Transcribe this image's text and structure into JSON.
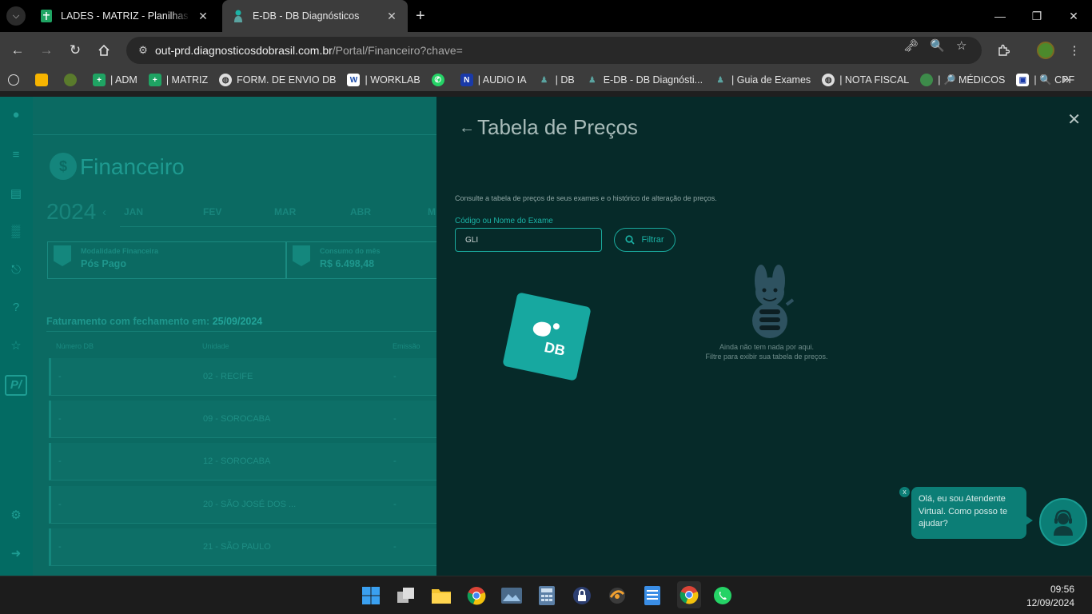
{
  "browser": {
    "tabs": [
      {
        "title": "LADES - MATRIZ - Planilhas Google",
        "active": false
      },
      {
        "title": "E-DB - DB Diagnósticos",
        "active": true
      }
    ],
    "url_host": "out-prd.diagnosticosdobrasil.com.br",
    "url_path": "/Portal/Financeiro?chave=",
    "bookmarks": [
      {
        "label": "",
        "icon": "openai-icon"
      },
      {
        "label": "",
        "icon": "keep-icon"
      },
      {
        "label": "",
        "icon": "badge-icon"
      },
      {
        "label": "| ADM",
        "icon": "sheets-icon"
      },
      {
        "label": "| MATRIZ",
        "icon": "sheets-icon"
      },
      {
        "label": "FORM. DE ENVIO DB",
        "icon": "globe-icon"
      },
      {
        "label": "| WORKLAB",
        "icon": "worklab-icon"
      },
      {
        "label": "",
        "icon": "whatsapp-icon"
      },
      {
        "label": "| AUDIO IA",
        "icon": "n-icon"
      },
      {
        "label": "| DB",
        "icon": "db-person-icon"
      },
      {
        "label": "E-DB - DB Diagnósti...",
        "icon": "db-person-icon"
      },
      {
        "label": "| Guia de Exames",
        "icon": "db-person-icon"
      },
      {
        "label": "| NOTA FISCAL",
        "icon": "globe-icon"
      },
      {
        "label": "| 🔎 MÉDICOS",
        "icon": "medico-icon"
      },
      {
        "label": "| 🔍 CPF",
        "icon": "receita-icon"
      }
    ]
  },
  "page": {
    "section_title": "Financeiro",
    "year": "2024",
    "months": [
      "JAN",
      "FEV",
      "MAR",
      "ABR",
      "M"
    ],
    "cards": [
      {
        "label": "Modalidade Financeira",
        "value": "Pós Pago"
      },
      {
        "label": "Consumo do mês",
        "value": "R$ 6.498,48"
      }
    ],
    "billing_title": "Faturamento com fechamento em:",
    "billing_date": "25/09/2024",
    "table_headers": [
      "Número DB",
      "Unidade",
      "Emissão"
    ],
    "rows": [
      {
        "num": "-",
        "unit": "02 - RECIFE",
        "emission": "-"
      },
      {
        "num": "-",
        "unit": "09 - SOROCABA",
        "emission": "-"
      },
      {
        "num": "-",
        "unit": "12 - SOROCABA",
        "emission": "-"
      },
      {
        "num": "-",
        "unit": "20 - SÃO JOSÉ DOS ...",
        "emission": "-"
      },
      {
        "num": "-",
        "unit": "21 - SÃO PAULO",
        "emission": "-"
      }
    ]
  },
  "drawer": {
    "title": "Tabela de Preços",
    "description": "Consulte a tabela de preços de seus exames e o histórico de alteração de preços.",
    "field_label": "Código ou Nome do Exame",
    "field_value": "GLI",
    "filter_label": "Filtrar",
    "logo_text": "DB",
    "empty_line1": "Ainda não tem nada por aqui.",
    "empty_line2": "Filtre para exibir sua tabela de preços."
  },
  "chat": {
    "message": "Olá, eu sou Atendente Virtual. Como posso te ajudar?",
    "close": "x"
  },
  "taskbar": {
    "time": "09:56",
    "date": "12/09/2024"
  },
  "colors": {
    "drawer_bg": "#062a29",
    "accent": "#1aa99d",
    "page_overlay": "#04675f"
  }
}
